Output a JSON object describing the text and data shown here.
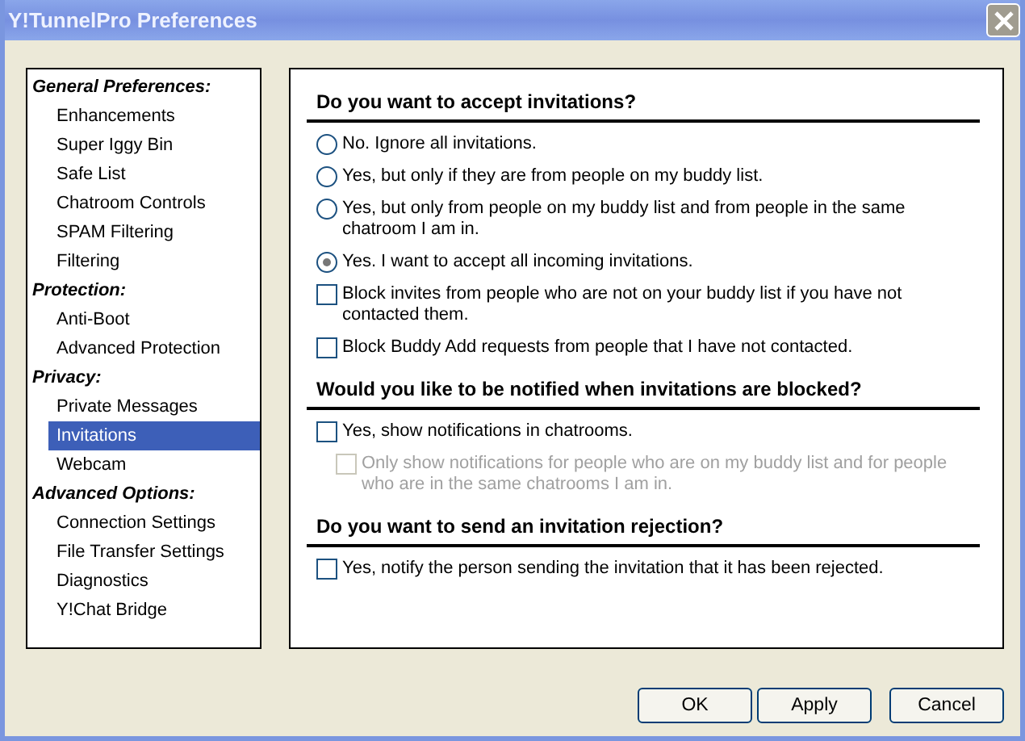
{
  "window": {
    "title": "Y!TunnelPro Preferences"
  },
  "sidebar": {
    "groups": [
      {
        "title": "General Preferences:",
        "items": [
          {
            "label": "Enhancements",
            "selected": false
          },
          {
            "label": "Super Iggy Bin",
            "selected": false
          },
          {
            "label": "Safe List",
            "selected": false
          },
          {
            "label": "Chatroom Controls",
            "selected": false
          },
          {
            "label": "SPAM Filtering",
            "selected": false
          },
          {
            "label": "Filtering",
            "selected": false
          }
        ]
      },
      {
        "title": "Protection:",
        "items": [
          {
            "label": "Anti-Boot",
            "selected": false
          },
          {
            "label": "Advanced Protection",
            "selected": false
          }
        ]
      },
      {
        "title": "Privacy:",
        "items": [
          {
            "label": "Private Messages",
            "selected": false
          },
          {
            "label": "Invitations",
            "selected": true
          },
          {
            "label": "Webcam",
            "selected": false
          }
        ]
      },
      {
        "title": "Advanced Options:",
        "items": [
          {
            "label": "Connection Settings",
            "selected": false
          },
          {
            "label": "File Transfer Settings",
            "selected": false
          },
          {
            "label": "Diagnostics",
            "selected": false
          },
          {
            "label": "Y!Chat Bridge",
            "selected": false
          }
        ]
      }
    ]
  },
  "sections": [
    {
      "heading": "Do you want to accept invitations?",
      "options": [
        {
          "kind": "radio",
          "label": "No. Ignore all invitations.",
          "selected": false
        },
        {
          "kind": "radio",
          "label": "Yes, but only if they are from people on my buddy list.",
          "selected": false
        },
        {
          "kind": "radio",
          "label": "Yes, but only from people on my buddy list and from people in the same chatroom I am in.",
          "selected": false
        },
        {
          "kind": "radio",
          "label": "Yes. I want to accept all incoming invitations.",
          "selected": true
        },
        {
          "kind": "checkbox",
          "label": "Block invites from people who are not on your buddy list if you have not contacted them.",
          "checked": false,
          "disabled": false
        },
        {
          "kind": "checkbox",
          "label": "Block Buddy Add requests from people that I have not contacted.",
          "checked": false,
          "disabled": false
        }
      ]
    },
    {
      "heading": "Would you like to be notified when invitations are blocked?",
      "options": [
        {
          "kind": "checkbox",
          "label": "Yes, show notifications in chatrooms.",
          "checked": false,
          "disabled": false,
          "children": [
            {
              "kind": "checkbox",
              "label": "Only show notifications for people who are on my buddy list and for people who are in the same chatrooms I am in.",
              "checked": false,
              "disabled": true
            }
          ]
        }
      ]
    },
    {
      "heading": "Do you want to send an invitation rejection?",
      "options": [
        {
          "kind": "checkbox",
          "label": "Yes, notify the person sending the invitation that it has been rejected.",
          "checked": false,
          "disabled": false
        }
      ]
    }
  ],
  "buttons": [
    "OK",
    "Apply",
    "Cancel"
  ]
}
